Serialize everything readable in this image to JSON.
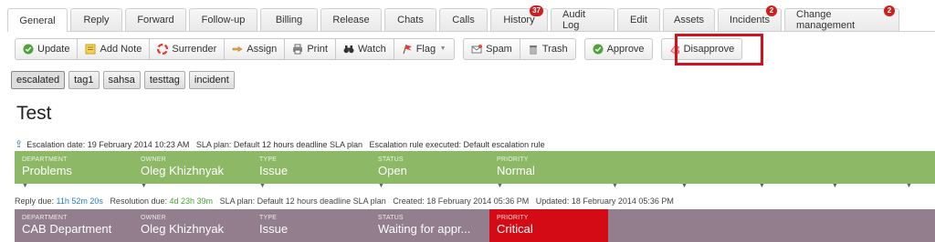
{
  "tabs": [
    {
      "label": "General",
      "active": true
    },
    {
      "label": "Reply"
    },
    {
      "label": "Forward"
    },
    {
      "label": "Follow-up"
    },
    {
      "label": "Billing"
    },
    {
      "label": "Release"
    },
    {
      "label": "Chats"
    },
    {
      "label": "Calls"
    },
    {
      "label": "History",
      "badge": "37"
    },
    {
      "label": "Audit Log"
    },
    {
      "label": "Edit"
    },
    {
      "label": "Assets"
    },
    {
      "label": "Incidents",
      "badge": "2"
    },
    {
      "label": "Change management",
      "badge": "2"
    }
  ],
  "toolbar": {
    "update": "Update",
    "add_note": "Add Note",
    "surrender": "Surrender",
    "assign": "Assign",
    "print": "Print",
    "watch": "Watch",
    "flag": "Flag",
    "spam": "Spam",
    "trash": "Trash",
    "approve": "Approve",
    "disapprove": "Disapprove"
  },
  "tags": [
    "escalated",
    "tag1",
    "sahsa",
    "testtag",
    "incident"
  ],
  "title": "Test",
  "escalation": "Escalation date: 19 February 2014 10:23 AM   SLA plan: Default 12 hours deadline SLA plan   Escalation rule executed: Default escalation rule",
  "bar1": {
    "department_label": "DEPARTMENT",
    "department": "Problems",
    "owner_label": "OWNER",
    "owner": "Oleg Khizhnyak",
    "type_label": "TYPE",
    "type": "Issue",
    "status_label": "STATUS",
    "status": "Open",
    "priority_label": "PRIORITY",
    "priority": "Normal"
  },
  "due": {
    "reply_label": "Reply due:",
    "reply": "11h 52m 20s",
    "resolution_label": "Resolution due:",
    "resolution": "4d 23h 39m",
    "rest": "SLA plan: Default 12 hours deadline SLA plan   Created: 18 February 2014 05:36 PM   Updated: 18 February 2014 05:36 PM"
  },
  "bar2": {
    "department_label": "DEPARTMENT",
    "department": "CAB Department",
    "owner_label": "OWNER",
    "owner": "Oleg Khizhnyak",
    "type_label": "TYPE",
    "type": "Issue",
    "status_label": "STATUS",
    "status": "Waiting for appr...",
    "priority_label": "PRIORITY",
    "priority": "Critical"
  },
  "colors": {
    "green_bar": "#8db866",
    "purple_bar": "#927e8d",
    "critical": "#d40a14",
    "highlight": "#d4101c"
  }
}
